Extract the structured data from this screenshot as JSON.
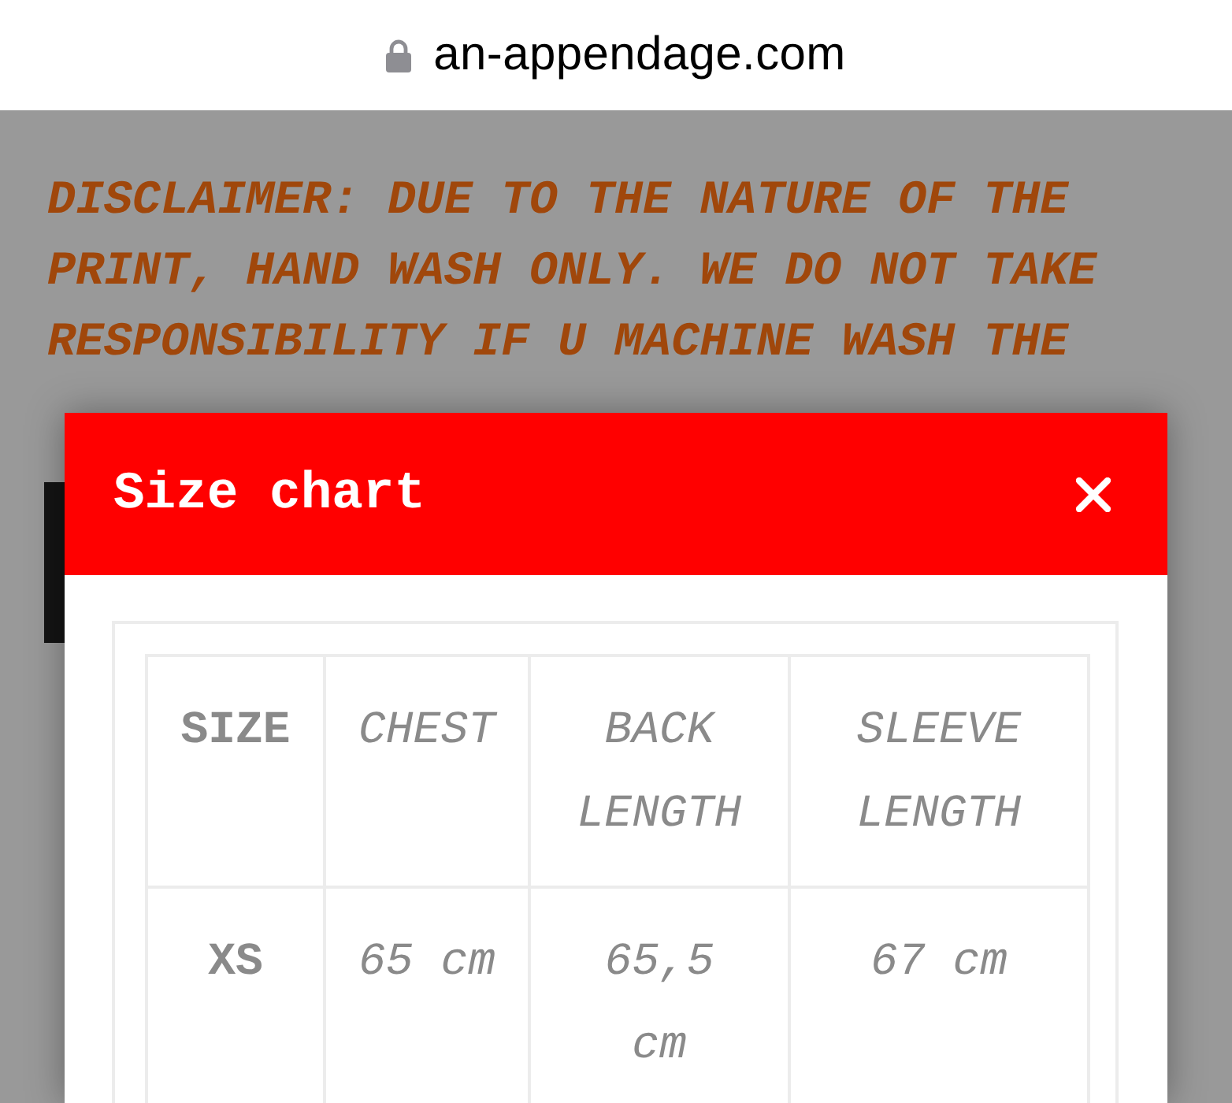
{
  "browser": {
    "url": "an-appendage.com"
  },
  "page": {
    "disclaimer": "DISCLAIMER: DUE TO THE NATURE OF THE PRINT, HAND WASH ONLY. WE DO NOT TAKE RESPONSIBILITY IF U MACHINE WASH THE"
  },
  "modal": {
    "title": "Size chart",
    "table": {
      "columns": [
        "SIZE",
        "CHEST",
        "BACK LENGTH",
        "SLEEVE LENGTH"
      ],
      "rows": [
        [
          "XS",
          "65 cm",
          "65,5 cm",
          "67 cm"
        ]
      ]
    }
  }
}
